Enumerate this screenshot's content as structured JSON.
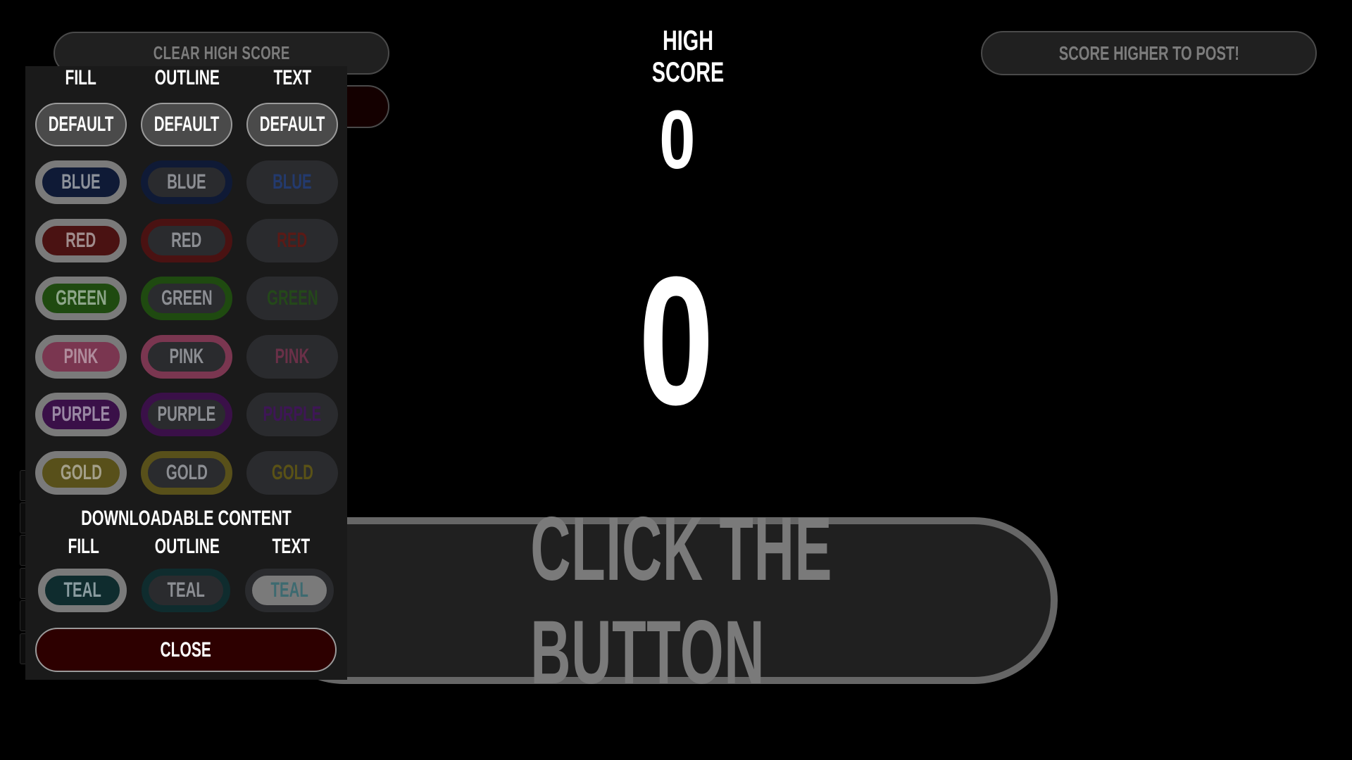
{
  "menu": {
    "clear_high_score_label": "CLEAR HIGH SCORE",
    "post_score_label": "SCORE HIGHER TO POST!"
  },
  "high_score": {
    "title": "HIGH SCORE",
    "value": "0"
  },
  "current_score": "0",
  "main_button": {
    "label": "CLICK THE BUTTON"
  },
  "customize_panel": {
    "columns": [
      "FILL",
      "OUTLINE",
      "TEXT"
    ],
    "default_label": "DEFAULT",
    "colors": [
      {
        "name": "BLUE",
        "color": "#0f1a36",
        "text_color": "#233a6e",
        "fill_text": "#8c919a"
      },
      {
        "name": "RED",
        "color": "#4a1212",
        "text_color": "#5a1a16",
        "fill_text": "#a08c8c"
      },
      {
        "name": "GREEN",
        "color": "#1f4a10",
        "text_color": "#24481a",
        "fill_text": "#8ea68a"
      },
      {
        "name": "PINK",
        "color": "#7a3650",
        "text_color": "#6a3048",
        "fill_text": "#b08c9c"
      },
      {
        "name": "PURPLE",
        "color": "#3a1048",
        "text_color": "#3e1656",
        "fill_text": "#9a88a4"
      },
      {
        "name": "GOLD",
        "color": "#58501a",
        "text_color": "#5a5216",
        "fill_text": "#a4a08a"
      }
    ],
    "dlc": {
      "title": "DOWNLOADABLE CONTENT",
      "columns": [
        "FILL",
        "OUTLINE",
        "TEXT"
      ],
      "items": [
        {
          "name": "TEAL",
          "color": "#0f2c2e",
          "text_color": "#3d6a70",
          "fill_text": "#8a9ca0"
        }
      ]
    },
    "close_label": "CLOSE"
  }
}
